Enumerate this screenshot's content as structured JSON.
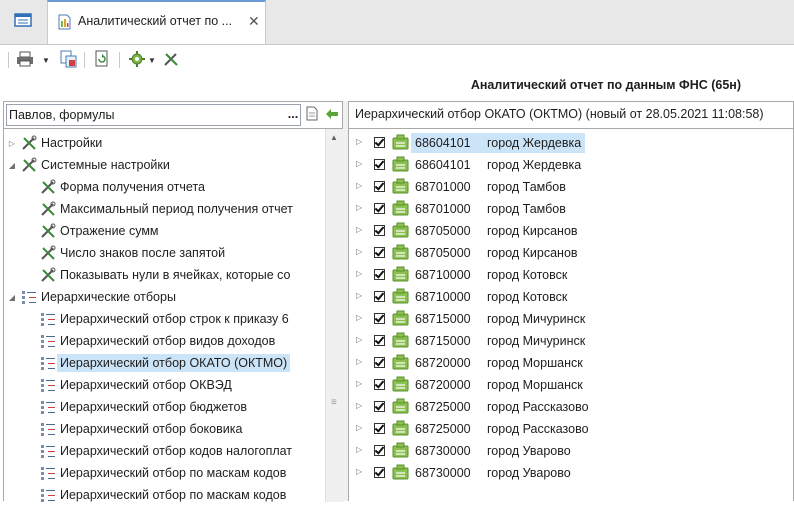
{
  "tabs": {
    "document_tab_title": "Аналитический отчет по ...",
    "close_glyph": "✕"
  },
  "toolbar": {
    "buttons": [
      "printer-icon",
      "dropdown-arrow",
      "export-icon",
      "refresh-icon",
      "gear-icon",
      "tools-icon"
    ]
  },
  "report_title": "Аналитический отчет по данным ФНС (65н)",
  "left_panel": {
    "search_value": "Павлов, формулы",
    "ellipsis": "...",
    "tree": [
      {
        "label": "Настройки",
        "level": 0,
        "expander": "collapsed",
        "icon": "tools-icon"
      },
      {
        "label": "Системные настройки",
        "level": 0,
        "expander": "expanded",
        "icon": "tools-icon"
      },
      {
        "label": "Форма получения отчета",
        "level": 1,
        "expander": "none",
        "icon": "tools-icon"
      },
      {
        "label": "Максимальный период получения отчет",
        "level": 1,
        "expander": "none",
        "icon": "tools-icon"
      },
      {
        "label": "Отражение сумм",
        "level": 1,
        "expander": "none",
        "icon": "tools-icon"
      },
      {
        "label": "Число знаков после запятой",
        "level": 1,
        "expander": "none",
        "icon": "tools-icon"
      },
      {
        "label": "Показывать нули в ячейках, которые со",
        "level": 1,
        "expander": "none",
        "icon": "tools-icon"
      },
      {
        "label": "Иерархические отборы",
        "level": 0,
        "expander": "expanded",
        "icon": "hierarchy-icon"
      },
      {
        "label": "Иерархический отбор строк к приказу 6",
        "level": 1,
        "expander": "none",
        "icon": "hierarchy-icon"
      },
      {
        "label": "Иерархический отбор видов доходов",
        "level": 1,
        "expander": "none",
        "icon": "hierarchy-icon"
      },
      {
        "label": "Иерархический отбор ОКАТО (ОКТМО)",
        "level": 1,
        "expander": "none",
        "icon": "hierarchy-icon",
        "selected": true
      },
      {
        "label": "Иерархический отбор ОКВЭД",
        "level": 1,
        "expander": "none",
        "icon": "hierarchy-icon"
      },
      {
        "label": "Иерархический отбор бюджетов",
        "level": 1,
        "expander": "none",
        "icon": "hierarchy-icon"
      },
      {
        "label": "Иерархический отбор боковика",
        "level": 1,
        "expander": "none",
        "icon": "hierarchy-icon"
      },
      {
        "label": "Иерархический отбор кодов налогоплат",
        "level": 1,
        "expander": "none",
        "icon": "hierarchy-icon"
      },
      {
        "label": "Иерархический отбор по маскам кодов",
        "level": 1,
        "expander": "none",
        "icon": "hierarchy-icon"
      },
      {
        "label": "Иерархический отбор по маскам кодов",
        "level": 1,
        "expander": "none",
        "icon": "hierarchy-icon"
      }
    ]
  },
  "right_panel": {
    "header": "Иерархический отбор ОКАТО (ОКТМО) (новый от 28.05.2021 11:08:58)",
    "rows": [
      {
        "code": "68604101",
        "name": "город Жердевка",
        "checked": true,
        "selected": true
      },
      {
        "code": "68604101",
        "name": "город Жердевка",
        "checked": true
      },
      {
        "code": "68701000",
        "name": "город Тамбов",
        "checked": true
      },
      {
        "code": "68701000",
        "name": "город Тамбов",
        "checked": true
      },
      {
        "code": "68705000",
        "name": "город Кирсанов",
        "checked": true
      },
      {
        "code": "68705000",
        "name": "город Кирсанов",
        "checked": true
      },
      {
        "code": "68710000",
        "name": "город Котовск",
        "checked": true
      },
      {
        "code": "68710000",
        "name": "город Котовск",
        "checked": true
      },
      {
        "code": "68715000",
        "name": "город Мичуринск",
        "checked": true
      },
      {
        "code": "68715000",
        "name": "город Мичуринск",
        "checked": true
      },
      {
        "code": "68720000",
        "name": "город Моршанск",
        "checked": true
      },
      {
        "code": "68720000",
        "name": "город Моршанск",
        "checked": true
      },
      {
        "code": "68725000",
        "name": "город Рассказово",
        "checked": true
      },
      {
        "code": "68725000",
        "name": "город Рассказово",
        "checked": true
      },
      {
        "code": "68730000",
        "name": "город Уварово",
        "checked": true
      },
      {
        "code": "68730000",
        "name": "город Уварово",
        "checked": true
      }
    ]
  },
  "colors": {
    "selection": "#cce4f7",
    "icon_green": "#7ab648",
    "accent_blue": "#2f6fb5"
  }
}
